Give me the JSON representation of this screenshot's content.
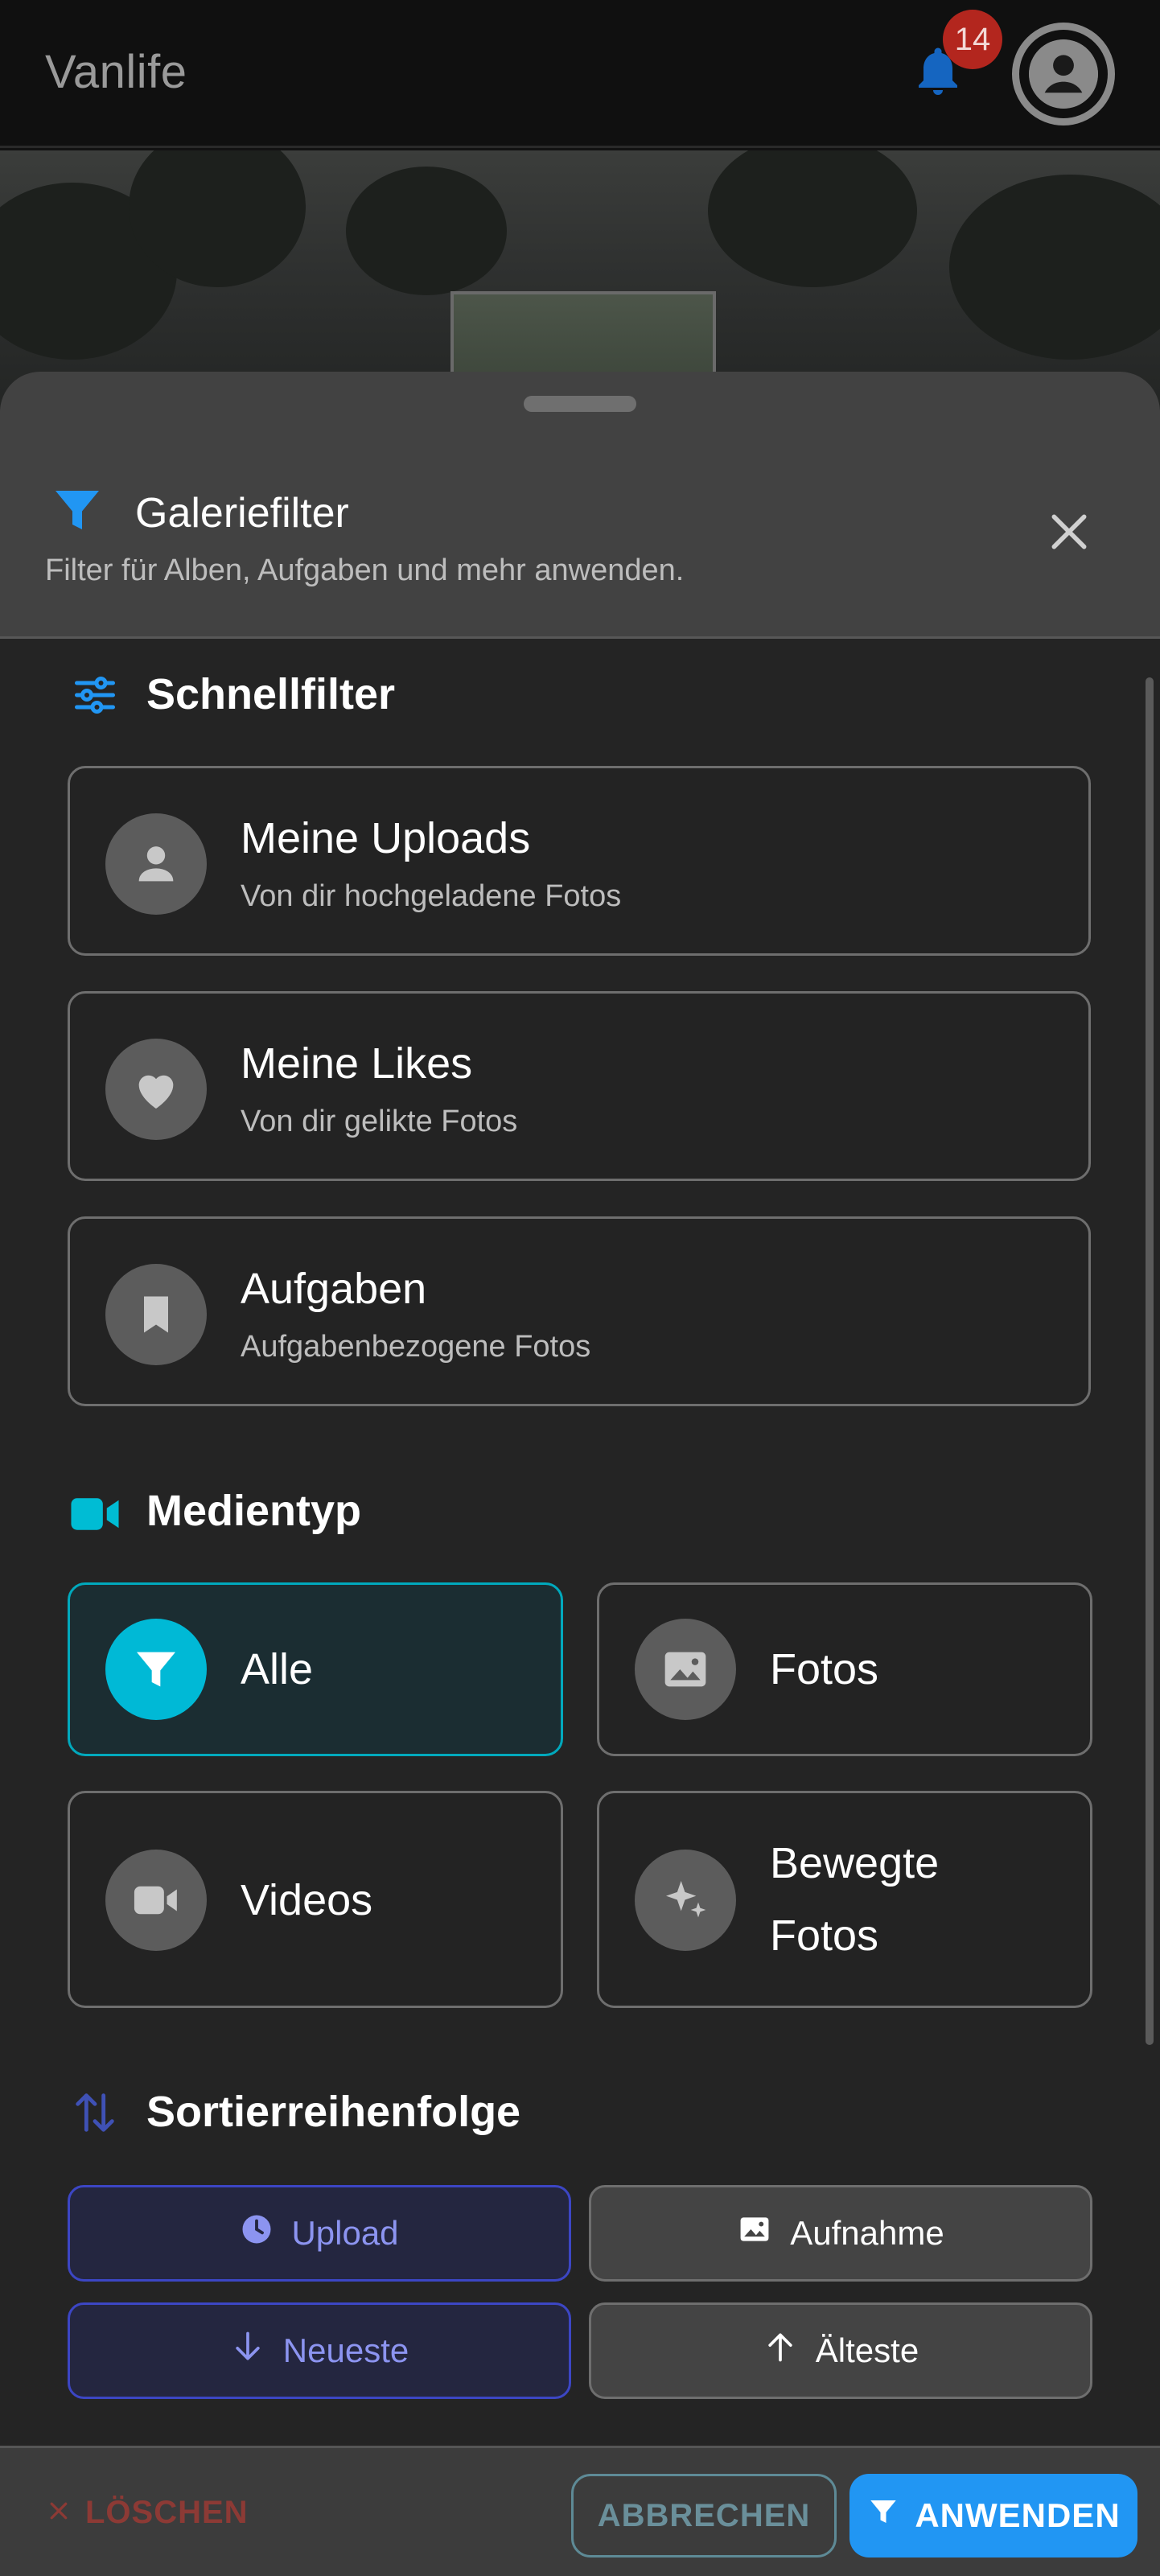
{
  "app": {
    "title": "Vanlife",
    "notification_count": "14"
  },
  "sheet": {
    "title": "Galeriefilter",
    "subtitle": "Filter für Alben, Aufgaben und mehr anwenden."
  },
  "quick_filters": {
    "title": "Schnellfilter",
    "items": [
      {
        "title": "Meine Uploads",
        "subtitle": "Von dir hochgeladene Fotos",
        "icon": "person-icon"
      },
      {
        "title": "Meine Likes",
        "subtitle": "Von dir gelikte Fotos",
        "icon": "heart-icon"
      },
      {
        "title": "Aufgaben",
        "subtitle": "Aufgabenbezogene Fotos",
        "icon": "bookmark-icon"
      }
    ]
  },
  "media_type": {
    "title": "Medientyp",
    "selected": "Alle",
    "items": [
      {
        "label": "Alle",
        "icon": "filter-icon"
      },
      {
        "label": "Fotos",
        "icon": "image-icon"
      },
      {
        "label": "Videos",
        "icon": "video-icon"
      },
      {
        "label_line1": "Bewegte",
        "label_line2": "Fotos",
        "icon": "sparkle-icon"
      }
    ]
  },
  "sort": {
    "title": "Sortierreihenfolge",
    "by": [
      {
        "label": "Upload",
        "selected": true,
        "icon": "clock-icon"
      },
      {
        "label": "Aufnahme",
        "selected": false,
        "icon": "image-icon"
      }
    ],
    "order": [
      {
        "label": "Neueste",
        "selected": true,
        "icon": "arrow-down-icon"
      },
      {
        "label": "Älteste",
        "selected": false,
        "icon": "arrow-up-icon"
      }
    ]
  },
  "footer": {
    "clear_label": "LÖSCHEN",
    "cancel_label": "ABBRECHEN",
    "apply_label": "ANWENDEN"
  },
  "colors": {
    "accent_blue": "#2196f3",
    "accent_cyan": "#00b9d6",
    "sort_selected": "#3c46c4",
    "danger": "#8c3a35",
    "badge": "#b3261e"
  }
}
